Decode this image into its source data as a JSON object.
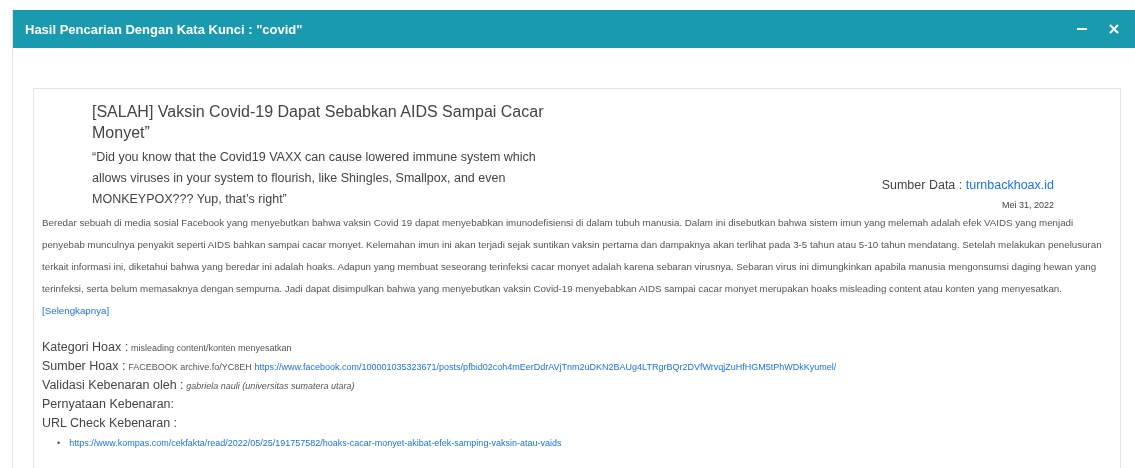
{
  "window": {
    "title": "Hasil Pencarian Dengan Kata Kunci : \"covid\"",
    "controls": [
      {
        "kind": "minimize"
      },
      {
        "kind": "close"
      }
    ]
  },
  "article": {
    "title": "[SALAH] Vaksin Covid-19 Dapat Sebabkan AIDS Sampai Cacar Monyet”",
    "quote": "“Did you know that the Covid19 VAXX can cause lowered immune system which allows viruses in your system to flourish, like Shingles, Smallpox, and even MONKEYPOX??? Yup, that’s right”",
    "source_label": "Sumber Data :",
    "source_link": "turnbackhoax.id",
    "date": "Mei 31, 2022",
    "summary": "Beredar sebuah di media sosial Facebook yang menyebutkan bahwa vaksin Covid 19 dapat menyebabkan imunodefisiensi di dalam tubuh manusia. Dalam ini disebutkan bahwa sistem imun yang melemah adalah efek VAIDS yang menjadi penyebab munculnya penyakit seperti AIDS bahkan sampai cacar monyet. Kelemahan imun ini akan terjadi sejak suntikan vaksin pertama dan dampaknya akan terlihat pada 3-5 tahun atau 5-10 tahun mendatang. Setelah melakukan penelusuran terkait informasi ini, diketahui bahwa yang beredar ini adalah hoaks. Adapun yang membuat seseorang terinfeksi cacar monyet adalah karena sebaran virusnya. Sebaran virus ini dimungkinkan apabila manusia mengonsumsi daging hewan yang terinfeksi, serta belum memasaknya dengan sempurna. Jadi dapat disimpulkan bahwa yang menyebutkan vaksin Covid-19 menyebabkan AIDS sampai cacar monyet merupakan hoaks misleading content atau konten yang menyesatkan.",
    "more_link": "[Selengkapnya]",
    "details": [
      {
        "label": "Kategori Hoax :",
        "parts": [
          {
            "kind": "plain",
            "text": "misleading content/konten menyesatkan"
          }
        ]
      },
      {
        "label": "Sumber Hoax :",
        "parts": [
          {
            "kind": "plain",
            "text": "FACEBOOK archive.fo/YC8EH"
          },
          {
            "kind": "link",
            "text": "https://www.facebook.com/100001035323671/posts/pfbid02coh4mEerDdrAVjTnm2uDKN2BAUg4LTRgrBQr2DVfWrvqjZuHfHGM5tPhWDkKyumel/"
          }
        ]
      },
      {
        "label": "Validasi Kebenaran oleh :",
        "parts": [
          {
            "kind": "italic",
            "text": "gabriela nauli (universitas sumatera utara)"
          }
        ]
      },
      {
        "label": "Pernyataan Kebenaran:"
      },
      {
        "label": "URL Check Kebenaran :"
      }
    ],
    "check_urls": [
      {
        "bullet": "•",
        "url": "https://www.kompas.com/cekfakta/read/2022/05/25/191757582/hoaks-cacar-monyet-akibat-efek-samping-vaksin-atau-vaids"
      }
    ]
  }
}
